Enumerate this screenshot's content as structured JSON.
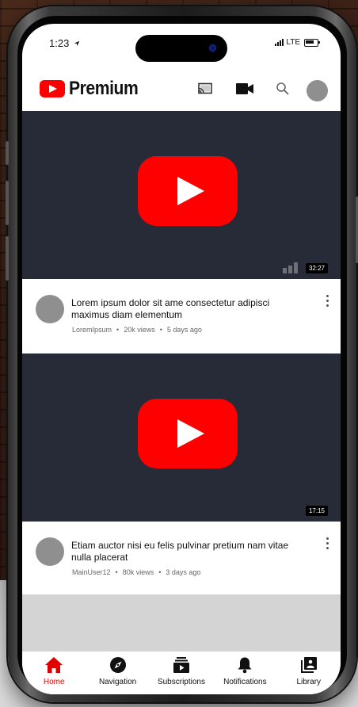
{
  "status_bar": {
    "time": "1:23",
    "network": "LTE"
  },
  "app_bar": {
    "brand": "Premium"
  },
  "videos": [
    {
      "duration": "32:27",
      "title": "Lorem ipsum dolor sit ame consectetur adipisci maximus diam elementum",
      "channel": "LoremIpsum",
      "views": "20k views",
      "age": "5 days ago"
    },
    {
      "duration": "17:15",
      "title": "Etiam auctor nisi eu felis pulvinar pretium nam vitae nulla placerat",
      "channel": "MainUser12",
      "views": "80k views",
      "age": "3 days ago"
    }
  ],
  "separator": "•",
  "tabs": [
    {
      "label": "Home",
      "icon": "home-icon",
      "active": true
    },
    {
      "label": "Navigation",
      "icon": "compass-icon",
      "active": false
    },
    {
      "label": "Subscriptions",
      "icon": "subscriptions-icon",
      "active": false
    },
    {
      "label": "Notifications",
      "icon": "bell-icon",
      "active": false
    },
    {
      "label": "Library",
      "icon": "library-icon",
      "active": false
    }
  ],
  "colors": {
    "brand_red": "#ff0000",
    "video_bg": "#272b38",
    "active_tab": "#e00000"
  }
}
